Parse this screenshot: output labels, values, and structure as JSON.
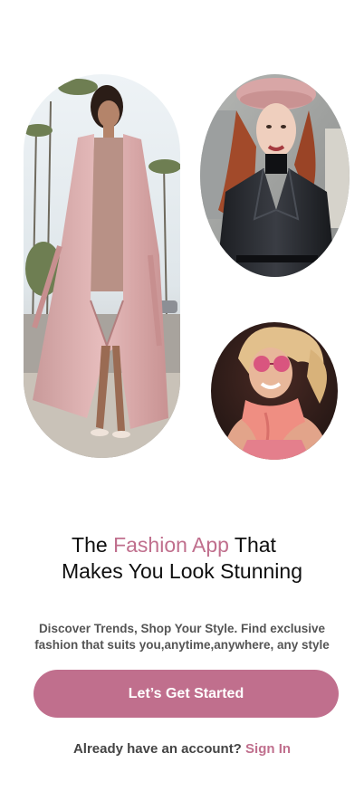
{
  "hero": {
    "images": [
      {
        "description": "woman in long pink trench coat on street"
      },
      {
        "description": "red-haired woman in pink beret and black leather coat"
      },
      {
        "description": "smiling woman with pink sunglasses and pink scarf"
      }
    ]
  },
  "headline": {
    "prefix": "The ",
    "accent": "Fashion App",
    "suffix": " That",
    "line2": "Makes You Look Stunning"
  },
  "subtitle": {
    "line1": "Discover Trends, Shop Your Style. Find exclusive",
    "line2": "fashion that suits you,anytime,anywhere, any style"
  },
  "cta": {
    "label": "Let’s Get Started"
  },
  "signin": {
    "prompt": "Already have an account? ",
    "link": "Sign In"
  },
  "colors": {
    "accent": "#c06f8d",
    "text_dark": "#0f0f0f",
    "text_muted": "#555555",
    "background": "#ffffff"
  }
}
